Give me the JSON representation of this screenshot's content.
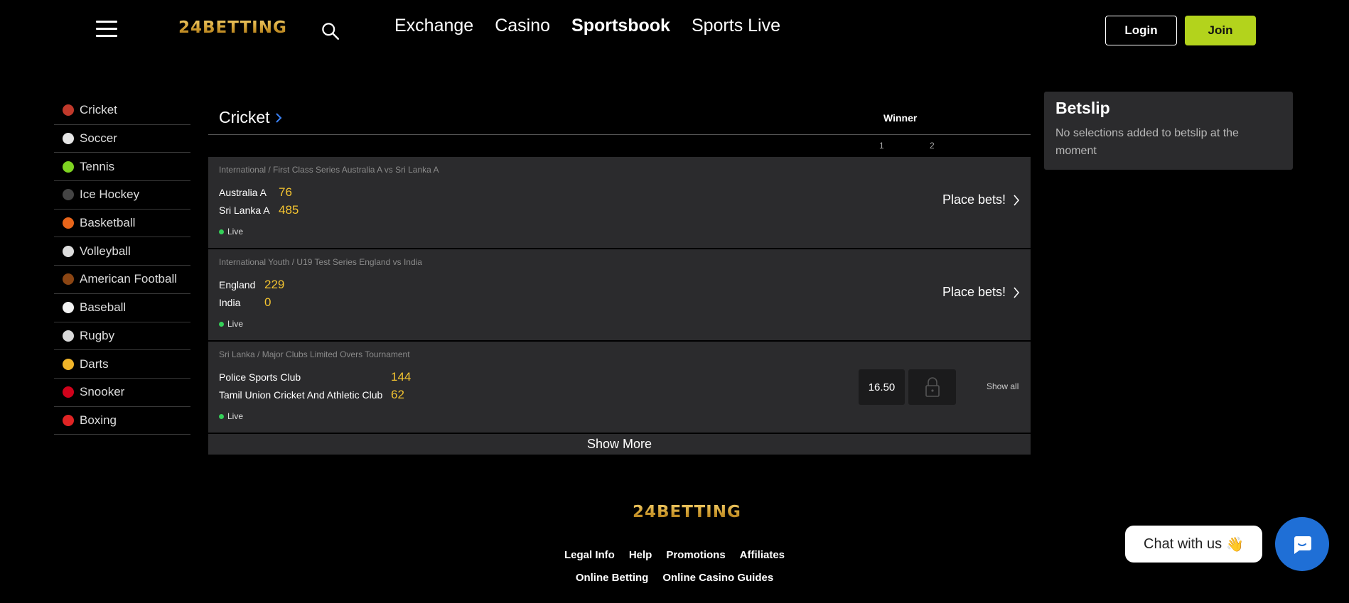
{
  "header": {
    "logo": "24BETTING",
    "nav": [
      {
        "label": "Exchange",
        "active": false
      },
      {
        "label": "Casino",
        "active": false
      },
      {
        "label": "Sportsbook",
        "active": true
      },
      {
        "label": "Sports Live",
        "active": false
      }
    ],
    "login_label": "Login",
    "join_label": "Join"
  },
  "sidebar": {
    "items": [
      {
        "label": "Cricket",
        "icon": "cricket-ball-icon",
        "color": "#c0392b"
      },
      {
        "label": "Soccer",
        "icon": "soccer-ball-icon",
        "color": "#e6e6e6"
      },
      {
        "label": "Tennis",
        "icon": "tennis-ball-icon",
        "color": "#7ed321"
      },
      {
        "label": "Ice Hockey",
        "icon": "hockey-puck-icon",
        "color": "#444444"
      },
      {
        "label": "Basketball",
        "icon": "basketball-icon",
        "color": "#e8651a"
      },
      {
        "label": "Volleyball",
        "icon": "volleyball-icon",
        "color": "#dddddd"
      },
      {
        "label": "American Football",
        "icon": "american-football-icon",
        "color": "#8b4513"
      },
      {
        "label": "Baseball",
        "icon": "baseball-icon",
        "color": "#f2f2f2"
      },
      {
        "label": "Rugby",
        "icon": "rugby-ball-icon",
        "color": "#d9d9d9"
      },
      {
        "label": "Darts",
        "icon": "dart-icon",
        "color": "#f0b429"
      },
      {
        "label": "Snooker",
        "icon": "snooker-ball-icon",
        "color": "#d0021b"
      },
      {
        "label": "Boxing",
        "icon": "boxing-glove-icon",
        "color": "#e02424"
      }
    ]
  },
  "main": {
    "title": "Cricket",
    "market_label": "Winner",
    "col1": "1",
    "col2": "2",
    "events": [
      {
        "competition": "International / First Class Series Australia A vs Sri Lanka A",
        "team1": "Australia A",
        "score1": "76",
        "team2": "Sri Lanka A",
        "score2": "485",
        "status": "Live",
        "action": "Place bets!"
      },
      {
        "competition": "International Youth / U19 Test Series England vs India",
        "team1": "England",
        "score1": "229",
        "team2": "India",
        "score2": "0",
        "status": "Live",
        "action": "Place bets!"
      },
      {
        "competition": "Sri Lanka / Major Clubs Limited Overs Tournament",
        "team1": "Police Sports Club",
        "score1": "144",
        "team2": "Tamil Union Cricket And Athletic Club",
        "score2": "62",
        "status": "Live",
        "odds1": "16.50",
        "show_all": "Show all"
      }
    ],
    "show_more": "Show More"
  },
  "betslip": {
    "title": "Betslip",
    "message": "No selections added to betslip at the moment"
  },
  "footer": {
    "logo": "24BETTING",
    "links_row1": [
      "Legal Info",
      "Help",
      "Promotions",
      "Affiliates"
    ],
    "links_row2": [
      "Online Betting",
      "Online Casino Guides"
    ]
  },
  "chat": {
    "label": "Chat with us"
  },
  "colors": {
    "accent_join": "#b3d31c",
    "score": "#f4c430",
    "live": "#34d058",
    "chat": "#1f6fd6"
  }
}
